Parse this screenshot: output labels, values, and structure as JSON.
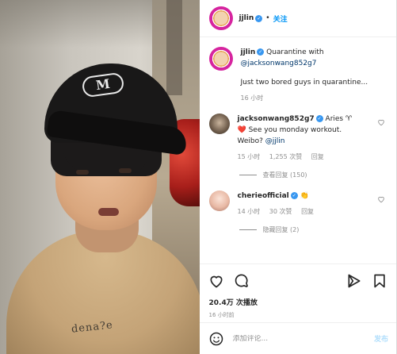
{
  "header": {
    "username": "jjlin",
    "dot": "•",
    "follow_label": "关注"
  },
  "caption": {
    "username": "jjlin",
    "text_prefix": "Quarantine with",
    "mention": "@jacksonwang852g7",
    "text_body": "Just two bored guys in quarantine...",
    "time": "16 小时"
  },
  "comments": [
    {
      "username": "jacksonwang852g7",
      "text": "Aries ♈",
      "text2": "See you monday workout.",
      "text3": "Weibo?",
      "mention": "@jjlin",
      "heart_emoji": "❤️",
      "time": "15 小时",
      "likes": "1,255 次赞",
      "reply": "回复",
      "view_replies": "查看回复 (150)"
    },
    {
      "username": "cherieofficial",
      "text": "👏",
      "time": "14 小时",
      "likes": "30 次赞",
      "reply": "回复",
      "view_replies": "隐藏回复 (2)"
    }
  ],
  "stats": {
    "plays": "20.4万 次播放",
    "time": "16 小时前"
  },
  "composer": {
    "placeholder": "添加评论...",
    "post_label": "发布"
  },
  "media": {
    "cap_logo": "M",
    "shirt_print": "dena?e"
  },
  "icons": {
    "like": "heart-icon",
    "comment": "comment-icon",
    "share": "share-icon",
    "save": "bookmark-icon",
    "emoji": "emoji-icon",
    "accent": "#0095f6",
    "verified": "#3897f0"
  }
}
